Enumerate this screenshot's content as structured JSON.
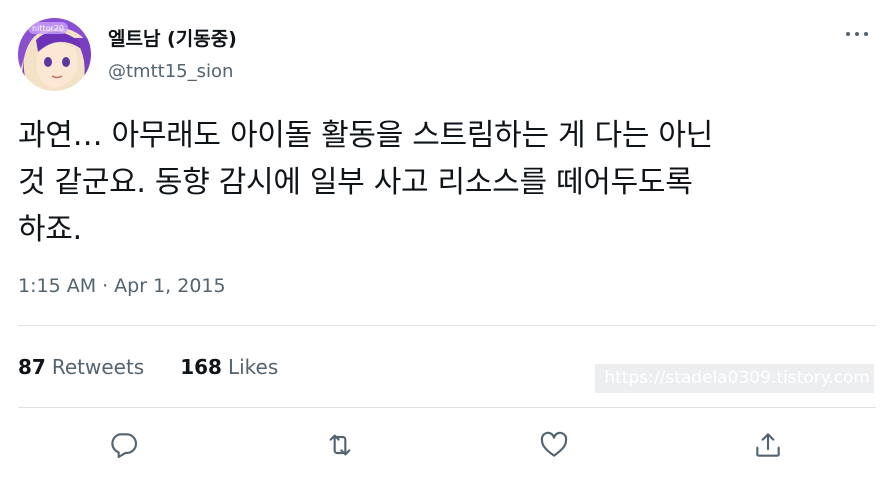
{
  "user": {
    "display_name": "엘트남 (기동중)",
    "handle": "@tmtt15_sion",
    "avatar_badge": "nittor20"
  },
  "tweet": {
    "lines": [
      "과연… 아무래도 아이돌 활동을 스트림하는 게 다는 아닌",
      "것 같군요. 동향 감시에 일부 사고 리소스를 떼어두도록",
      "하죠."
    ],
    "time": "1:15 AM",
    "separator": "·",
    "date": "Apr 1, 2015"
  },
  "stats": {
    "retweets_count": "87",
    "retweets_label": "Retweets",
    "likes_count": "168",
    "likes_label": "Likes"
  },
  "watermark": "https://stadela0309.tistory.com",
  "actions": {
    "reply_icon": "reply-icon",
    "retweet_icon": "retweet-icon",
    "like_icon": "heart-icon",
    "share_icon": "share-icon"
  },
  "colors": {
    "text_primary": "#0f1419",
    "text_secondary": "#536471",
    "divider": "#dfe3e7"
  }
}
